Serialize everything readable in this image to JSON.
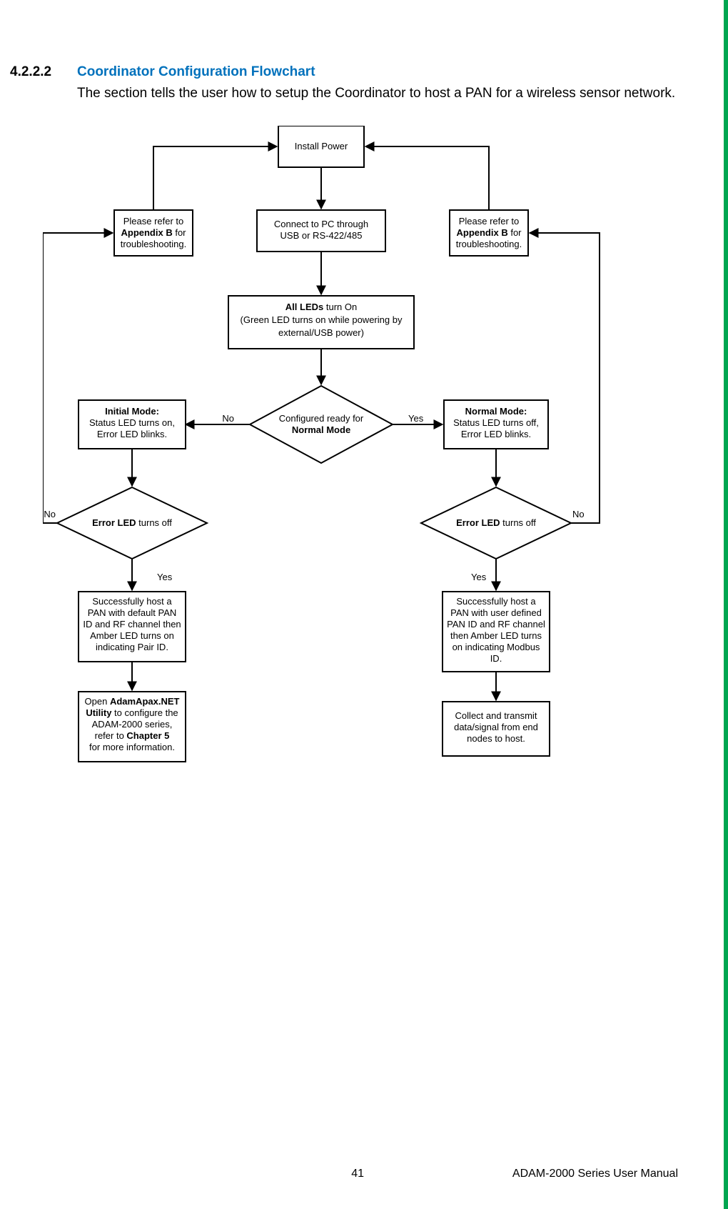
{
  "heading": {
    "number": "4.2.2.2",
    "title": "Coordinator Configuration Flowchart",
    "description": "The section tells the user how to setup the Coordinator to host a PAN for a wireless sensor network."
  },
  "flow": {
    "installPower": "Install Power",
    "connectPC_l1": "Connect to PC through",
    "connectPC_l2": "USB or RS-422/485",
    "appendixB_l1": "Please refer to",
    "appendixB_bold": "Appendix B",
    "appendixB_l2a": " for",
    "appendixB_l3": "troubleshooting.",
    "allLeds_bold": "All LEDs",
    "allLeds_l1b": " turn On",
    "allLeds_l2": "(Green LED turns on while powering by",
    "allLeds_l3": "external/USB power)",
    "decision_l1": "Configured ready for",
    "decision_bold": "Normal Mode",
    "no": "No",
    "yes": "Yes",
    "initialMode_bold": "Initial Mode:",
    "initialMode_l2": "Status LED turns on,",
    "initialMode_l3": "Error LED blinks.",
    "normalMode_bold": "Normal Mode:",
    "normalMode_l2": "Status LED turns off,",
    "normalMode_l3": "Error LED blinks.",
    "errorLed_bold": "Error LED",
    "errorLed_rest": " turns off",
    "hostDefault_l1": "Successfully host a",
    "hostDefault_l2": "PAN with default PAN",
    "hostDefault_l3": "ID and RF channel then",
    "hostDefault_l4": "Amber LED turns on",
    "hostDefault_l5": "indicating Pair ID.",
    "hostUser_l1": "Successfully host a",
    "hostUser_l2": "PAN with user defined",
    "hostUser_l3": "PAN ID and RF channel",
    "hostUser_l4": "then Amber LED turns",
    "hostUser_l5": "on indicating Modbus",
    "hostUser_l6": "ID.",
    "openUtility_l1a": "Open ",
    "openUtility_bold": "AdamApax.NET",
    "openUtility_bold2": "Utility",
    "openUtility_l2b": " to configure the",
    "openUtility_l3": "ADAM-2000 series,",
    "openUtility_l4a": "refer to ",
    "openUtility_bold3": "Chapter 5",
    "openUtility_l5": "for more information.",
    "collect_l1": "Collect and transmit",
    "collect_l2": "data/signal from end",
    "collect_l3": "nodes to host."
  },
  "footer": {
    "pageNumber": "41",
    "docTitle": "ADAM-2000 Series User Manual"
  }
}
